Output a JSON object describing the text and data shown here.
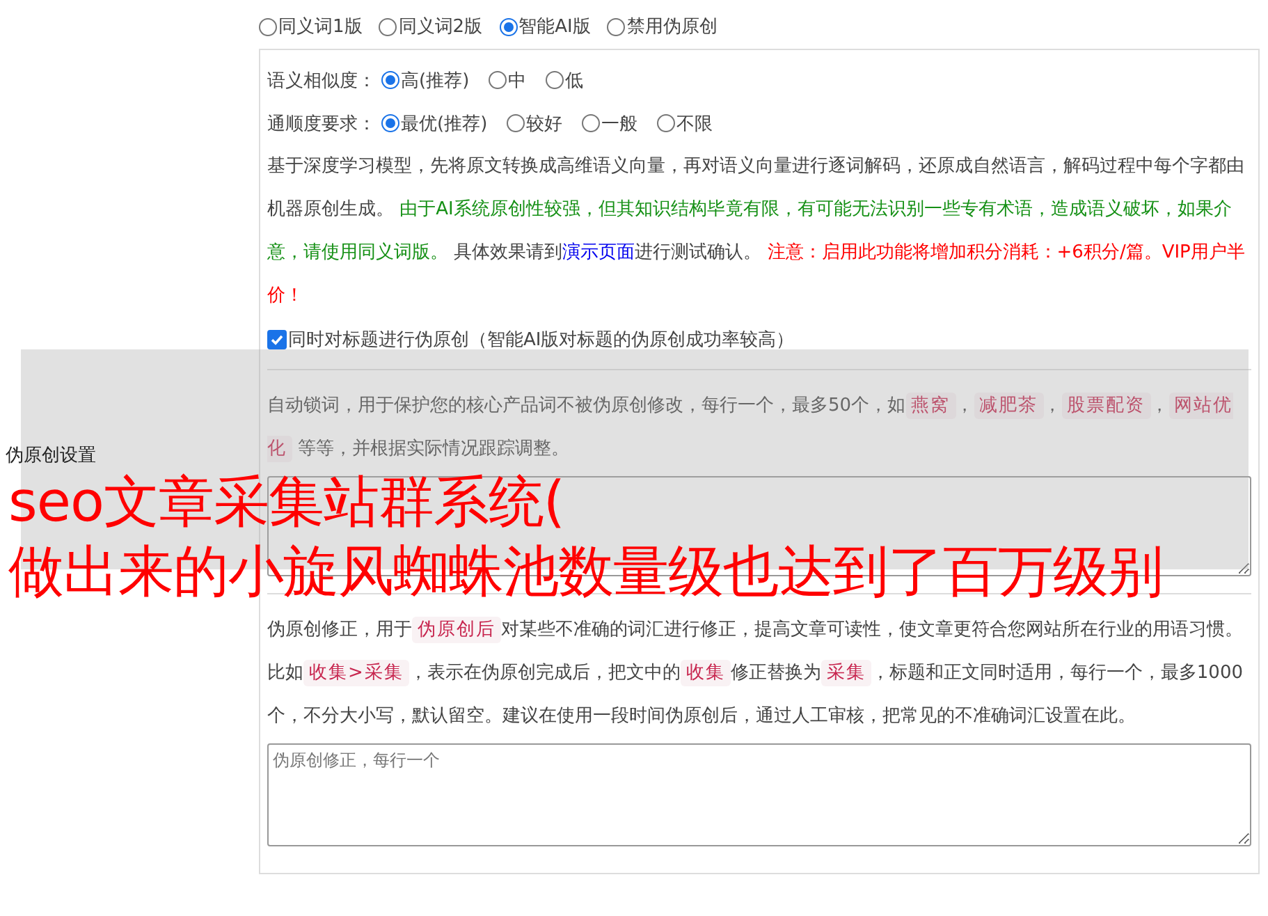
{
  "section_label": "伪原创设置",
  "modes": [
    {
      "label": "同义词1版",
      "selected": false
    },
    {
      "label": "同义词2版",
      "selected": false
    },
    {
      "label": "智能AI版",
      "selected": true
    },
    {
      "label": "禁用伪原创",
      "selected": false
    }
  ],
  "similarity": {
    "label": "语义相似度：",
    "options": [
      {
        "label": "高(推荐)",
        "selected": true
      },
      {
        "label": "中",
        "selected": false
      },
      {
        "label": "低",
        "selected": false
      }
    ]
  },
  "fluency": {
    "label": "通顺度要求：",
    "options": [
      {
        "label": "最优(推荐)",
        "selected": true
      },
      {
        "label": "较好",
        "selected": false
      },
      {
        "label": "一般",
        "selected": false
      },
      {
        "label": "不限",
        "selected": false
      }
    ]
  },
  "description": [
    {
      "kind": "text",
      "text": "基于深度学习模型，先将原文转换成高维语义向量，再对语义向量进行逐词解码，还原成自然语言，解码过程中每个字都由机器原创生成。 "
    },
    {
      "kind": "hint",
      "text": "由于AI系统原创性较强，但其知识结构毕竟有限，有可能无法识别一些专有术语，造成语义破坏，如果介意，请使用同义词版。"
    },
    {
      "kind": "text",
      "text": " 具体效果请到"
    },
    {
      "kind": "link",
      "text": "演示页面"
    },
    {
      "kind": "text",
      "text": "进行测试确认。 "
    },
    {
      "kind": "warning",
      "text": "注意：启用此功能将增加积分消耗：+6积分/篇。VIP用户半价！"
    }
  ],
  "title_option": {
    "label": "同时对标题进行伪原创（智能AI版对标题的伪原创成功率较高）",
    "checked": true
  },
  "lock_words": {
    "description": [
      {
        "kind": "text",
        "text": "自动锁词，用于保护您的核心产品词不被伪原创修改，每行一个，最多50个，如"
      },
      {
        "kind": "tag",
        "text": "燕窝"
      },
      {
        "kind": "text",
        "text": "，"
      },
      {
        "kind": "tag",
        "text": "减肥茶"
      },
      {
        "kind": "text",
        "text": "，"
      },
      {
        "kind": "tag",
        "text": "股票配资"
      },
      {
        "kind": "text",
        "text": "，"
      },
      {
        "kind": "tag",
        "text": "网站优化"
      },
      {
        "kind": "text",
        "text": " 等等，并根据实际情况跟踪调整。"
      }
    ]
  },
  "correction": {
    "description": [
      {
        "kind": "text",
        "text": "伪原创修正，用于"
      },
      {
        "kind": "tag",
        "text": "伪原创后"
      },
      {
        "kind": "text",
        "text": "对某些不准确的词汇进行修正，提高文章可读性，使文章更符合您网站所在行业的用语习惯。比如"
      },
      {
        "kind": "tag",
        "text": "收集>采集"
      },
      {
        "kind": "text",
        "text": "，表示在伪原创完成后，把文中的"
      },
      {
        "kind": "tag",
        "text": "收集"
      },
      {
        "kind": "text",
        "text": "修正替换为"
      },
      {
        "kind": "tag",
        "text": "采集"
      },
      {
        "kind": "text",
        "text": "，标题和正文同时适用，每行一个，最多1000个，不分大小写，默认留空。建议在使用一段时间伪原创后，通过人工审核，把常见的不准确词汇设置在此。"
      }
    ],
    "placeholder": "伪原创修正，每行一个"
  },
  "overlay": {
    "lines": [
      "seo文章采集站群系统(",
      "做出来的小旋风蜘蛛池数量级也达到了百万级别"
    ]
  }
}
